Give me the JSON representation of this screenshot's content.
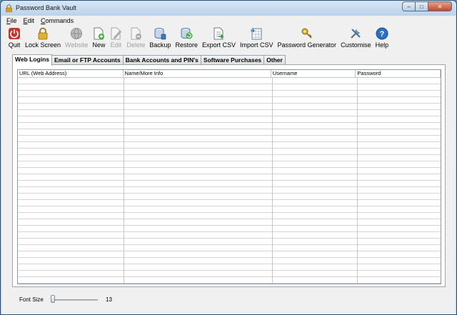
{
  "window": {
    "title": "Password Bank Vault"
  },
  "menu": [
    {
      "letter": "F",
      "rest": "ile"
    },
    {
      "letter": "E",
      "rest": "dit"
    },
    {
      "letter": "C",
      "rest": "ommands"
    }
  ],
  "toolbar": {
    "quit": "Quit",
    "lock": "Lock Screen",
    "website": "Website",
    "new": "New",
    "edit": "Edit",
    "delete": "Delete",
    "backup": "Backup",
    "restore": "Restore",
    "export": "Export CSV",
    "import": "Import CSV",
    "generator": "Password Generator",
    "customise": "Customise",
    "help": "Help"
  },
  "tabs": [
    "Web Logins",
    "Email or FTP Accounts",
    "Bank Accounts and PIN's",
    "Software Purchases",
    "Other"
  ],
  "grid": {
    "columns": [
      "URL (Web Address)",
      "Name/More Info",
      "Username",
      "Password"
    ]
  },
  "status": {
    "font_label": "Font Size",
    "font_value": "13",
    "font_level": 0.0
  },
  "colors": {
    "quit": "#c0392b",
    "help": "#2b6fc6",
    "accent": "#3c78b4"
  }
}
